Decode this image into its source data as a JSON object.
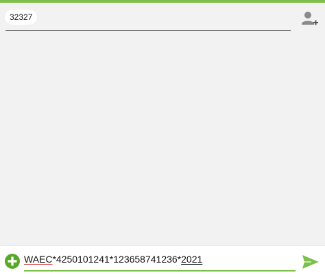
{
  "header": {
    "recipient": "32327",
    "add_contact_icon": "person-add-icon"
  },
  "composer": {
    "message": {
      "word1": "WAEC",
      "mid": "*4250101241*123658741236*",
      "word2": "2021"
    },
    "attach_icon": "plus-circle-icon",
    "send_icon": "send-arrow-icon"
  },
  "colors": {
    "accent": "#7cbf4a",
    "background": "#f2f2f2",
    "spell_error": "#d23b3b"
  }
}
